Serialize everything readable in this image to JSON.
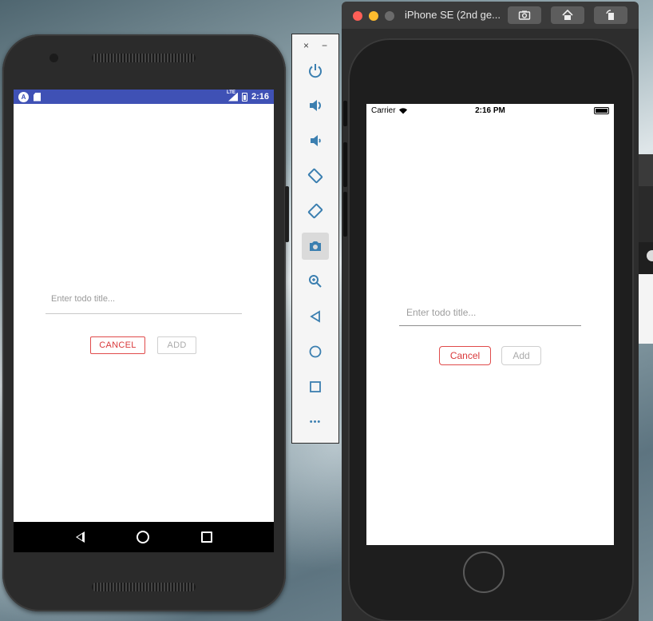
{
  "android": {
    "status_time": "2:16",
    "status_lte": "LTE",
    "status_bar_color": "#3f51b5",
    "input_placeholder": "Enter todo title...",
    "cancel_label": "CANCEL",
    "add_label": "ADD",
    "accent_color": "#d9383a"
  },
  "emulator_toolbar": {
    "close_glyph": "×",
    "minimize_glyph": "−",
    "items": [
      {
        "icon": "power-icon"
      },
      {
        "icon": "volume-up-icon"
      },
      {
        "icon": "volume-down-icon"
      },
      {
        "icon": "rotate-left-icon"
      },
      {
        "icon": "rotate-right-icon"
      },
      {
        "icon": "camera-icon"
      },
      {
        "icon": "zoom-icon"
      },
      {
        "icon": "back-icon"
      },
      {
        "icon": "home-icon"
      },
      {
        "icon": "overview-icon"
      },
      {
        "icon": "more-icon"
      }
    ],
    "more_glyph": "•••"
  },
  "ios": {
    "window_title": "iPhone SE (2nd ge...",
    "carrier": "Carrier",
    "status_time": "2:16 PM",
    "input_placeholder": "Enter todo title...",
    "cancel_label": "Cancel",
    "add_label": "Add"
  }
}
